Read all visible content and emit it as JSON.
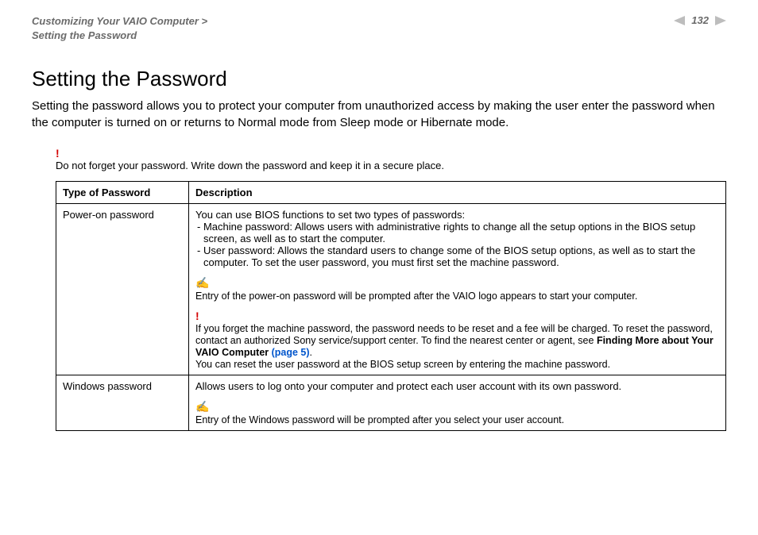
{
  "header": {
    "breadcrumb_line1": "Customizing Your VAIO Computer >",
    "breadcrumb_line2": "Setting the Password",
    "page_number": "132"
  },
  "title": "Setting the Password",
  "intro": "Setting the password allows you to protect your computer from unauthorized access by making the user enter the password when the computer is turned on or returns to Normal mode from Sleep mode or Hibernate mode.",
  "top_warning": {
    "mark": "!",
    "text": "Do not forget your password. Write down the password and keep it in a secure place."
  },
  "table": {
    "head": {
      "type": "Type of Password",
      "desc": "Description"
    },
    "rows": [
      {
        "type": "Power-on password",
        "lead": "You can use BIOS functions to set two types of passwords:",
        "bullets": [
          "Machine password: Allows users with administrative rights to change all the setup options in the BIOS setup screen, as well as to start the computer.",
          "User password: Allows the standard users to change some of the BIOS setup options, as well as to start the computer. To set the user password, you must first set the machine password."
        ],
        "note_icon": "✍",
        "note": "Entry of the power-on password will be prompted after the VAIO logo appears to start your computer.",
        "warn_mark": "!",
        "warn_pre": "If you forget the machine password, the password needs to be reset and a fee will be charged. To reset the password, contact an authorized Sony service/support center. To find the nearest center or agent, see ",
        "warn_bold": "Finding More about Your VAIO Computer ",
        "warn_link": "(page 5)",
        "warn_post": ".",
        "warn_tail": "You can reset the user password at the BIOS setup screen by entering the machine password."
      },
      {
        "type": "Windows password",
        "lead": "Allows users to log onto your computer and protect each user account with its own password.",
        "note_icon": "✍",
        "note": "Entry of the Windows password will be prompted after you select your user account."
      }
    ]
  }
}
